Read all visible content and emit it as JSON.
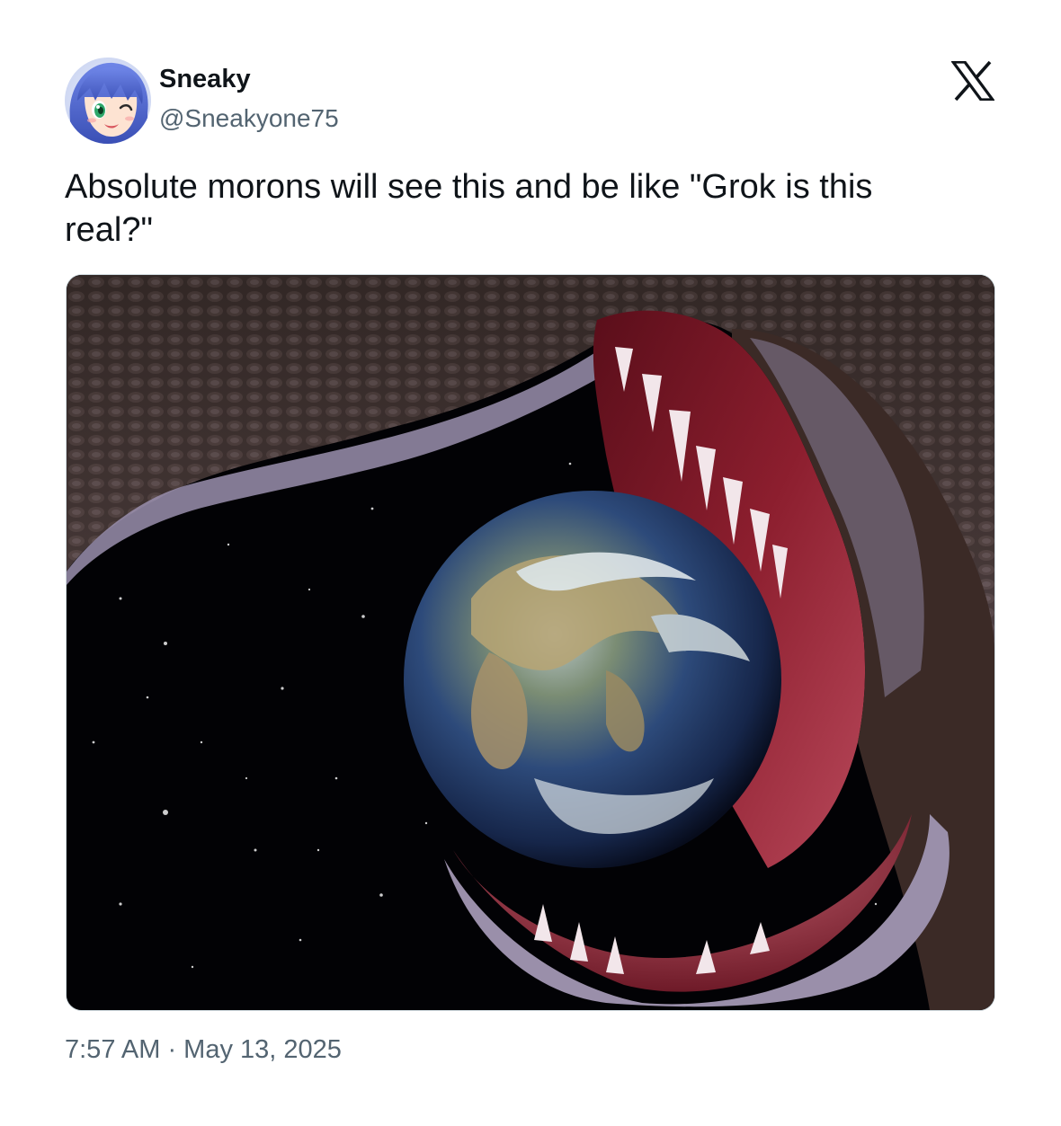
{
  "author": {
    "display_name": "Sneaky",
    "handle": "@Sneakyone75",
    "avatar_icon": "anime-avatar-icon"
  },
  "platform": {
    "logo_icon": "x-logo-icon",
    "logo_glyph": "𝕏"
  },
  "tweet": {
    "text": "Absolute morons will see this and be like \"Grok is this real?\"",
    "timestamp": "7:57 AM · May 13, 2025"
  },
  "media": {
    "icon": "earth-in-snake-mouth-image"
  },
  "colors": {
    "text_primary": "#0f1419",
    "text_secondary": "#536471",
    "border": "#cfd9de",
    "background": "#ffffff"
  }
}
